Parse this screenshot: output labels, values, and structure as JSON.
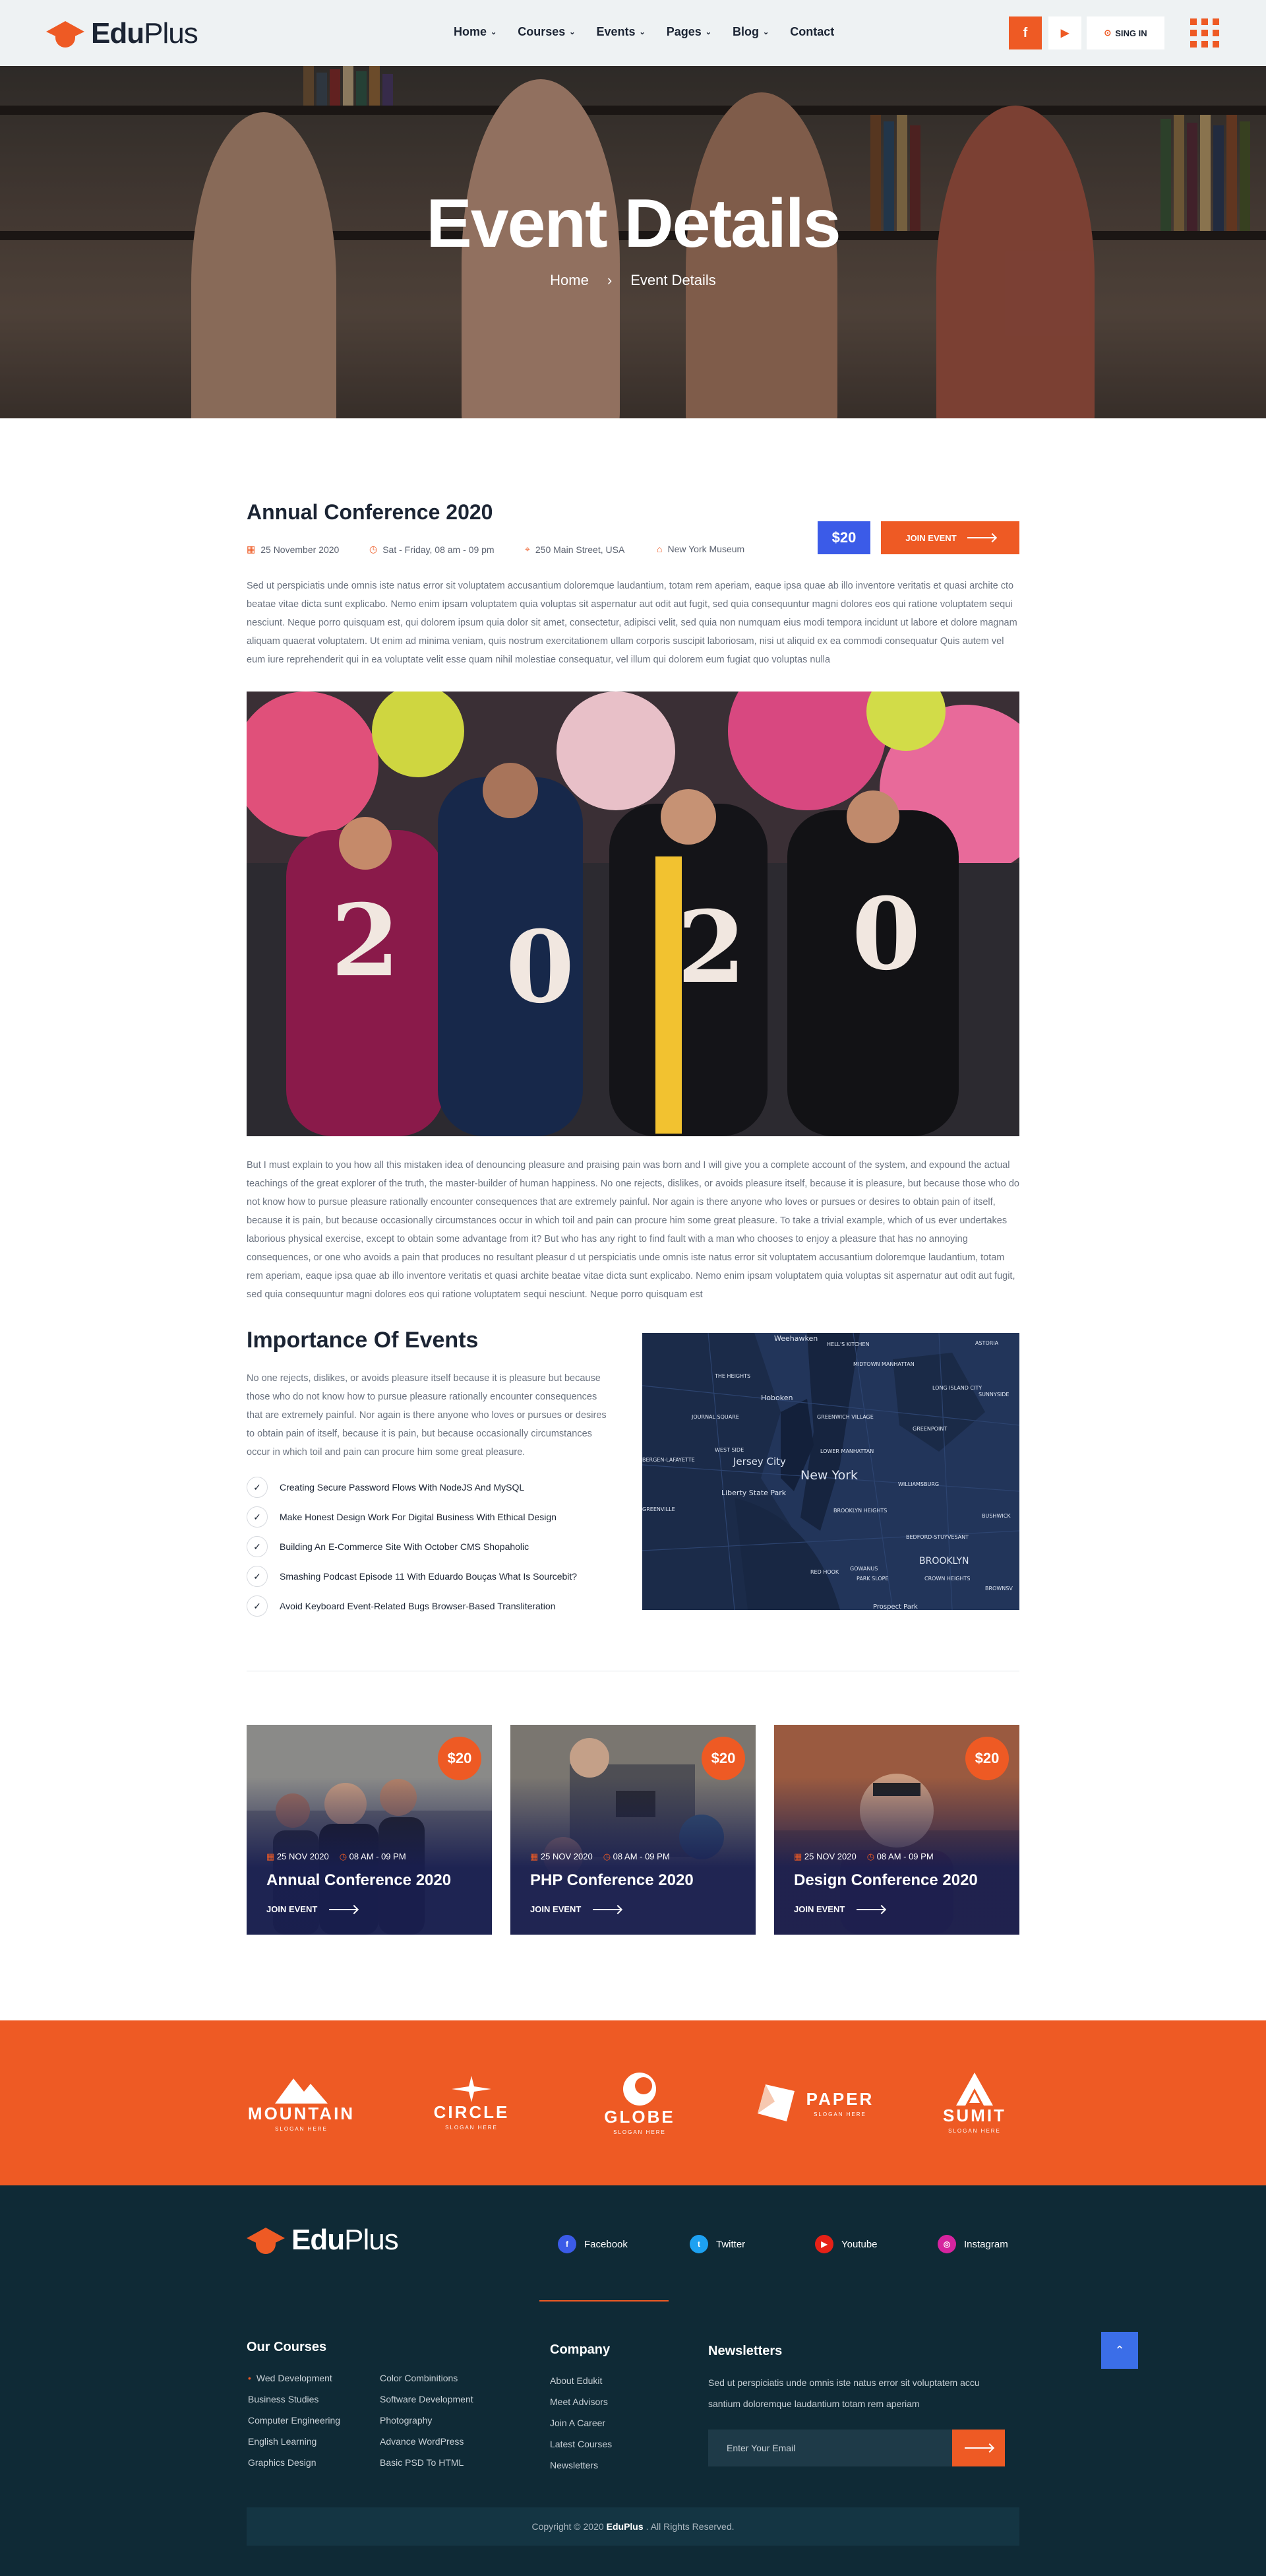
{
  "header": {
    "logo_bold": "Edu",
    "logo_light": "Plus",
    "nav": [
      {
        "label": "Home",
        "has_dropdown": true
      },
      {
        "label": "Courses",
        "has_dropdown": true
      },
      {
        "label": "Events",
        "has_dropdown": true
      },
      {
        "label": "Pages",
        "has_dropdown": true
      },
      {
        "label": "Blog",
        "has_dropdown": true
      },
      {
        "label": "Contact",
        "has_dropdown": false
      }
    ],
    "facebook_icon": "f",
    "youtube_icon": "▶",
    "sign_in": "SING IN"
  },
  "hero": {
    "title": "Event Details",
    "breadcrumb_home": "Home",
    "breadcrumb_sep": "›",
    "breadcrumb_current": "Event Details"
  },
  "event": {
    "title": "Annual Conference 2020",
    "date": "25 November 2020",
    "time": "Sat - Friday, 08 am - 09 pm",
    "address": "250 Main Street, USA",
    "venue": "New York Museum",
    "price": "$20",
    "join_label": "JOIN EVENT",
    "intro": "Sed ut perspiciatis unde omnis iste natus error sit voluptatem accusantium doloremque laudantium, totam rem aperiam, eaque ipsa quae ab illo inventore veritatis et quasi archite cto beatae vitae dicta sunt explicabo. Nemo enim ipsam voluptatem quia voluptas sit aspernatur aut odit aut fugit, sed quia consequuntur magni dolores eos qui ratione voluptatem sequi nesciunt. Neque porro quisquam est, qui dolorem ipsum quia dolor sit amet, consectetur, adipisci velit, sed quia non numquam eius modi tempora incidunt ut labore et dolore magnam aliquam quaerat voluptatem. Ut enim ad minima veniam, quis nostrum exercitationem ullam corporis suscipit laboriosam, nisi ut aliquid ex ea commodi consequatur Quis autem vel eum iure reprehenderit qui in ea voluptate velit esse quam nihil molestiae consequatur, vel illum qui dolorem eum fugiat quo voluptas nulla",
    "photo_digits": [
      "2",
      "0",
      "2",
      "0"
    ],
    "body": "But I must explain to you how all this mistaken idea of denouncing pleasure and praising pain was born and I will give you a complete account of the system, and expound the actual teachings of the great explorer of the truth, the master-builder of human happiness. No one rejects, dislikes, or avoids pleasure itself, because it is pleasure, but because those who do not know how to pursue pleasure rationally encounter consequences that are extremely painful. Nor again is there anyone who loves or pursues or desires to obtain pain of itself, because it is pain, but because occasionally circumstances occur in which toil and pain can procure him some great pleasure. To take a trivial example, which of us ever undertakes laborious physical exercise, except to obtain some advantage from it? But who has any right to find fault with a man who chooses to enjoy a pleasure that has no annoying consequences, or one who avoids a pain that produces no resultant pleasur d ut perspiciatis unde omnis iste natus error sit voluptatem accusantium doloremque laudantium, totam rem aperiam, eaque ipsa quae ab illo inventore veritatis et quasi archite  beatae vitae dicta sunt explicabo. Nemo enim ipsam voluptatem quia voluptas sit aspernatur aut odit aut fugit, sed quia consequuntur magni dolores eos qui ratione voluptatem sequi nesciunt. Neque porro quisquam est"
  },
  "importance": {
    "title": "Importance Of Events",
    "text": "No one rejects, dislikes, or avoids pleasure itself because it is pleasure but because those who do not know how to pursue pleasure rationally encounter consequences that are extremely painful. Nor again is there anyone who loves or pursues or desires  to obtain pain of itself, because it is pain, but because occasionally circumstances occur in which toil and pain can procure him some great pleasure.",
    "items": [
      "Creating Secure Password Flows With NodeJS And MySQL",
      "Make Honest Design Work For Digital Business With Ethical Design",
      "Building An E-Commerce Site With October CMS Shopaholic",
      "Smashing Podcast Episode 11 With Eduardo Bouças What Is Sourcebit?",
      "Avoid Keyboard Event-Related Bugs Browser-Based Transliteration"
    ],
    "map_labels": [
      "Weehawken",
      "HELL'S KITCHEN",
      "ASTORIA",
      "THE HEIGHTS",
      "MIDTOWN MANHATTAN",
      "LONG ISLAND CITY",
      "SUNNYSIDE",
      "Hoboken",
      "JOURNAL SQUARE",
      "GREENWICH VILLAGE",
      "GREENPOINT",
      "WEST SIDE",
      "LOWER MANHATTAN",
      "Jersey City",
      "New York",
      "BERGEN-LAFAYETTE",
      "WILLIAMSBURG",
      "Liberty State Park",
      "GREENVILLE",
      "BROOKLYN HEIGHTS",
      "BUSHWICK",
      "BEDFORD-STUYVESANT",
      "RED HOOK",
      "GOWANUS",
      "PARK SLOPE",
      "BROOKLYN",
      "CROWN HEIGHTS",
      "BROWNSV",
      "Prospect Park"
    ]
  },
  "related": [
    {
      "price": "$20",
      "date": "25 NOV 2020",
      "time": "08 AM - 09 PM",
      "title": "Annual Conference 2020",
      "join": "JOIN EVENT"
    },
    {
      "price": "$20",
      "date": "25 NOV 2020",
      "time": "08 AM - 09 PM",
      "title": "PHP Conference 2020",
      "join": "JOIN EVENT"
    },
    {
      "price": "$20",
      "date": "25 NOV 2020",
      "time": "08 AM - 09 PM",
      "title": "Design Conference 2020",
      "join": "JOIN EVENT"
    }
  ],
  "partners": [
    {
      "name": "MOUNTAIN",
      "slogan": "SLOGAN HERE"
    },
    {
      "name": "CIRCLE",
      "slogan": "SLOGAN HERE"
    },
    {
      "name": "GLOBE",
      "slogan": "SLOGAN HERE"
    },
    {
      "name": "PAPER",
      "slogan": "SLOGAN HERE"
    },
    {
      "name": "SUMIT",
      "slogan": "SLOGAN HERE"
    }
  ],
  "footer": {
    "social": [
      {
        "label": "Facebook",
        "icon": "f",
        "color": "#3b5be8"
      },
      {
        "label": "Twitter",
        "icon": "t",
        "color": "#1da1f2"
      },
      {
        "label": "Youtube",
        "icon": "▶",
        "color": "#e62117"
      },
      {
        "label": "Instagram",
        "icon": "◎",
        "color": "#d6249f"
      }
    ],
    "courses_title": "Our Courses",
    "courses_col1": [
      "Wed Development",
      "Business Studies",
      "Computer Engineering",
      "English Learning",
      "Graphics Design"
    ],
    "courses_col2": [
      "Color Combinitions",
      "Software Development",
      "Photography",
      "Advance WordPress",
      "Basic PSD To HTML"
    ],
    "company_title": "Company",
    "company_links": [
      "About Edukit",
      "Meet Advisors",
      "Join A Career",
      "Latest Courses",
      "Newsletters"
    ],
    "newsletter_title": "Newsletters",
    "newsletter_text": "Sed ut perspiciatis unde omnis iste natus error sit voluptatem accu santium doloremque laudantium totam rem aperiam",
    "email_placeholder": "Enter Your Email",
    "to_top": "⌃",
    "copy_pre": "Copyright © 2020",
    "copy_brand": "EduPlus",
    "copy_post": ". All Rights Reserved."
  },
  "colors": {
    "accent": "#ee5a24",
    "blue": "#3b5be8",
    "dark": "#0f2a36"
  }
}
